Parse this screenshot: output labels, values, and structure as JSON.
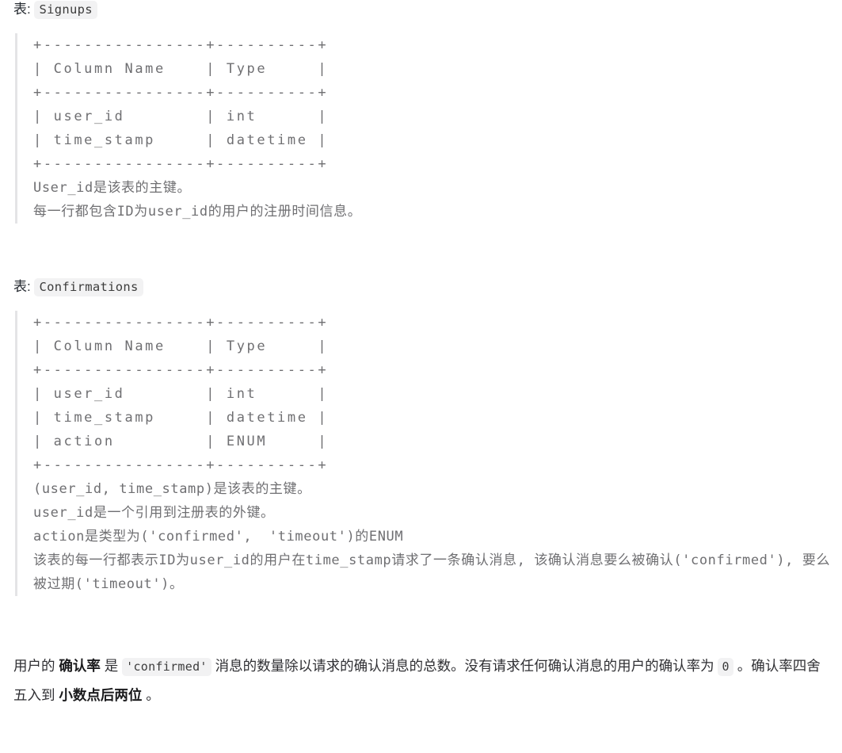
{
  "sections": [
    {
      "heading_label": "表:",
      "heading_code": "Signups",
      "ascii_table": "+----------------+----------+\n| Column Name    | Type     |\n+----------------+----------+\n| user_id        | int      |\n| time_stamp     | datetime |\n+----------------+----------+",
      "notes": [
        "User_id是该表的主键。",
        "每一行都包含ID为user_id的用户的注册时间信息。"
      ]
    },
    {
      "heading_label": "表:",
      "heading_code": "Confirmations",
      "ascii_table": "+----------------+----------+\n| Column Name    | Type     |\n+----------------+----------+\n| user_id        | int      |\n| time_stamp     | datetime |\n| action         | ENUM     |\n+----------------+----------+",
      "notes": [
        "(user_id, time_stamp)是该表的主键。",
        "user_id是一个引用到注册表的外键。",
        "action是类型为('confirmed',  'timeout')的ENUM",
        "该表的每一行都表示ID为user_id的用户在time_stamp请求了一条确认消息, 该确认消息要么被确认('confirmed'), 要么被过期('timeout')。"
      ]
    }
  ],
  "closing": {
    "part1": "用户的 ",
    "bold1": "确认率",
    "part2": " 是 ",
    "code1": "'confirmed'",
    "part3": " 消息的数量除以请求的确认消息的总数。没有请求任何确认消息的用户的确认率为 ",
    "code2": "0",
    "part4": " 。确认率四舍五入到 ",
    "bold2": "小数点后两位",
    "part5": " 。"
  },
  "colors": {
    "background": "#ffffff",
    "body_text": "#2f2f33",
    "mono_text": "#6f6f72",
    "inline_code_bg": "#f2f2f3",
    "quote_border": "#e4e4e6"
  }
}
